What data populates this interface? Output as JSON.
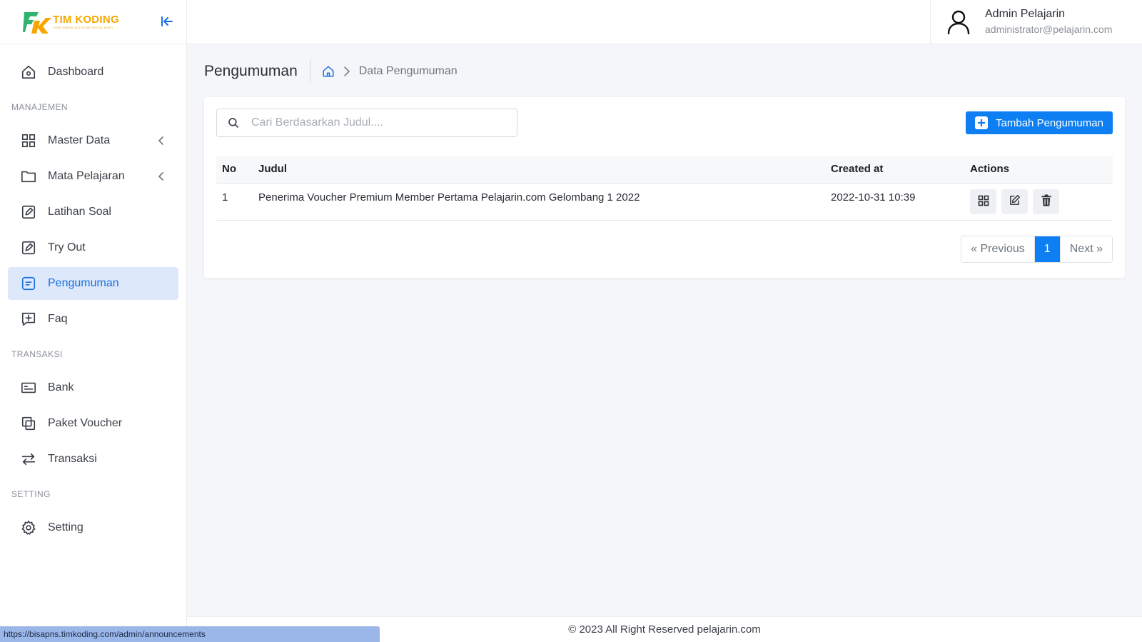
{
  "brand": {
    "name": "TIM KODING",
    "tagline": "YOUR DREAM SOLUTION DIGITAL BUILD"
  },
  "colors": {
    "accent": "#0d7ff2",
    "active_bg": "#dde9fb",
    "active_text": "#1a6fe0",
    "logo_orange": "#f7a600",
    "logo_green": "#2fb36f"
  },
  "sidebar": {
    "sections": {
      "manajemen": "MANAJEMEN",
      "transaksi": "TRANSAKSI",
      "setting": "SETTING"
    },
    "items": {
      "dashboard": {
        "label": "Dashboard",
        "icon": "home-icon"
      },
      "master_data": {
        "label": "Master Data",
        "icon": "grid-icon"
      },
      "mata_pelajaran": {
        "label": "Mata Pelajaran",
        "icon": "folder-icon"
      },
      "latihan_soal": {
        "label": "Latihan Soal",
        "icon": "edit-square-icon"
      },
      "try_out": {
        "label": "Try Out",
        "icon": "edit-square-icon"
      },
      "pengumuman": {
        "label": "Pengumuman",
        "icon": "message-square-icon"
      },
      "faq": {
        "label": "Faq",
        "icon": "message-plus-icon"
      },
      "bank": {
        "label": "Bank",
        "icon": "bank-card-icon"
      },
      "paket_voucher": {
        "label": "Paket Voucher",
        "icon": "copy-icon"
      },
      "transaksi": {
        "label": "Transaksi",
        "icon": "arrows-swap-icon"
      },
      "setting": {
        "label": "Setting",
        "icon": "gear-icon"
      }
    }
  },
  "user": {
    "name": "Admin Pelajarin",
    "email": "administrator@pelajarin.com"
  },
  "page": {
    "title": "Pengumuman",
    "breadcrumb_current": "Data Pengumuman"
  },
  "search": {
    "placeholder": "Cari Berdasarkan Judul...."
  },
  "add_button": "Tambah Pengumuman",
  "table": {
    "headers": {
      "no": "No",
      "judul": "Judul",
      "created": "Created at",
      "actions": "Actions"
    },
    "rows": [
      {
        "no": "1",
        "judul": "Penerima Voucher Premium Member Pertama Pelajarin.com Gelombang 1 2022",
        "created": "2022-10-31 10:39"
      }
    ]
  },
  "pagination": {
    "previous": "« Previous",
    "current": "1",
    "next": "Next »"
  },
  "footer": "© 2023 All Right Reserved pelajarin.com",
  "status_url": "https://bisapns.timkoding.com/admin/announcements"
}
